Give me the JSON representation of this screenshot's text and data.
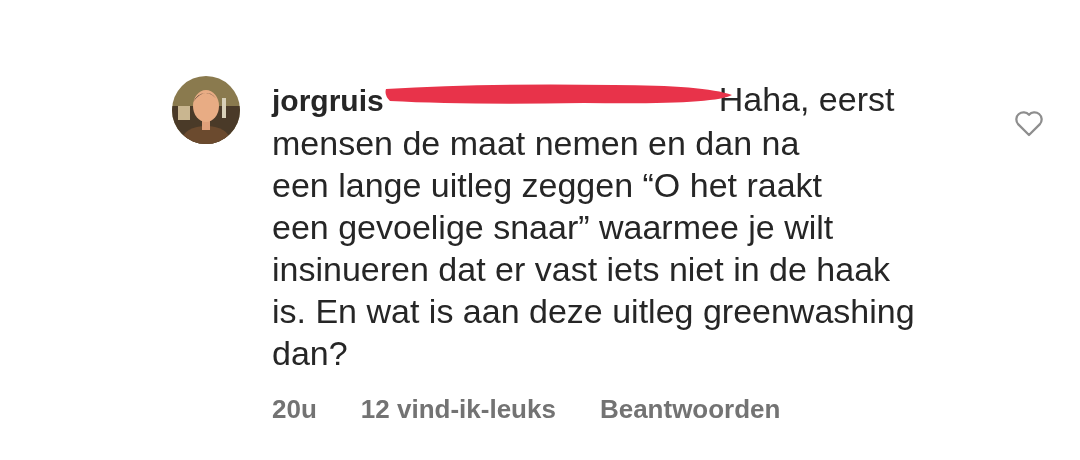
{
  "comment": {
    "username": "jorgruis",
    "mention_redacted": true,
    "lines": [
      "Haha, eerst",
      "mensen de maat nemen en dan na",
      "een lange uitleg zeggen “O het raakt",
      "een gevoelige snaar” waarmee je wilt",
      "insinueren dat er vast iets niet in de haak",
      "is. En wat is aan deze uitleg greenwashing",
      "dan?"
    ],
    "liked": false,
    "time": "20u",
    "likes": "12 vind-ik-leuks",
    "reply": "Beantwoorden"
  }
}
